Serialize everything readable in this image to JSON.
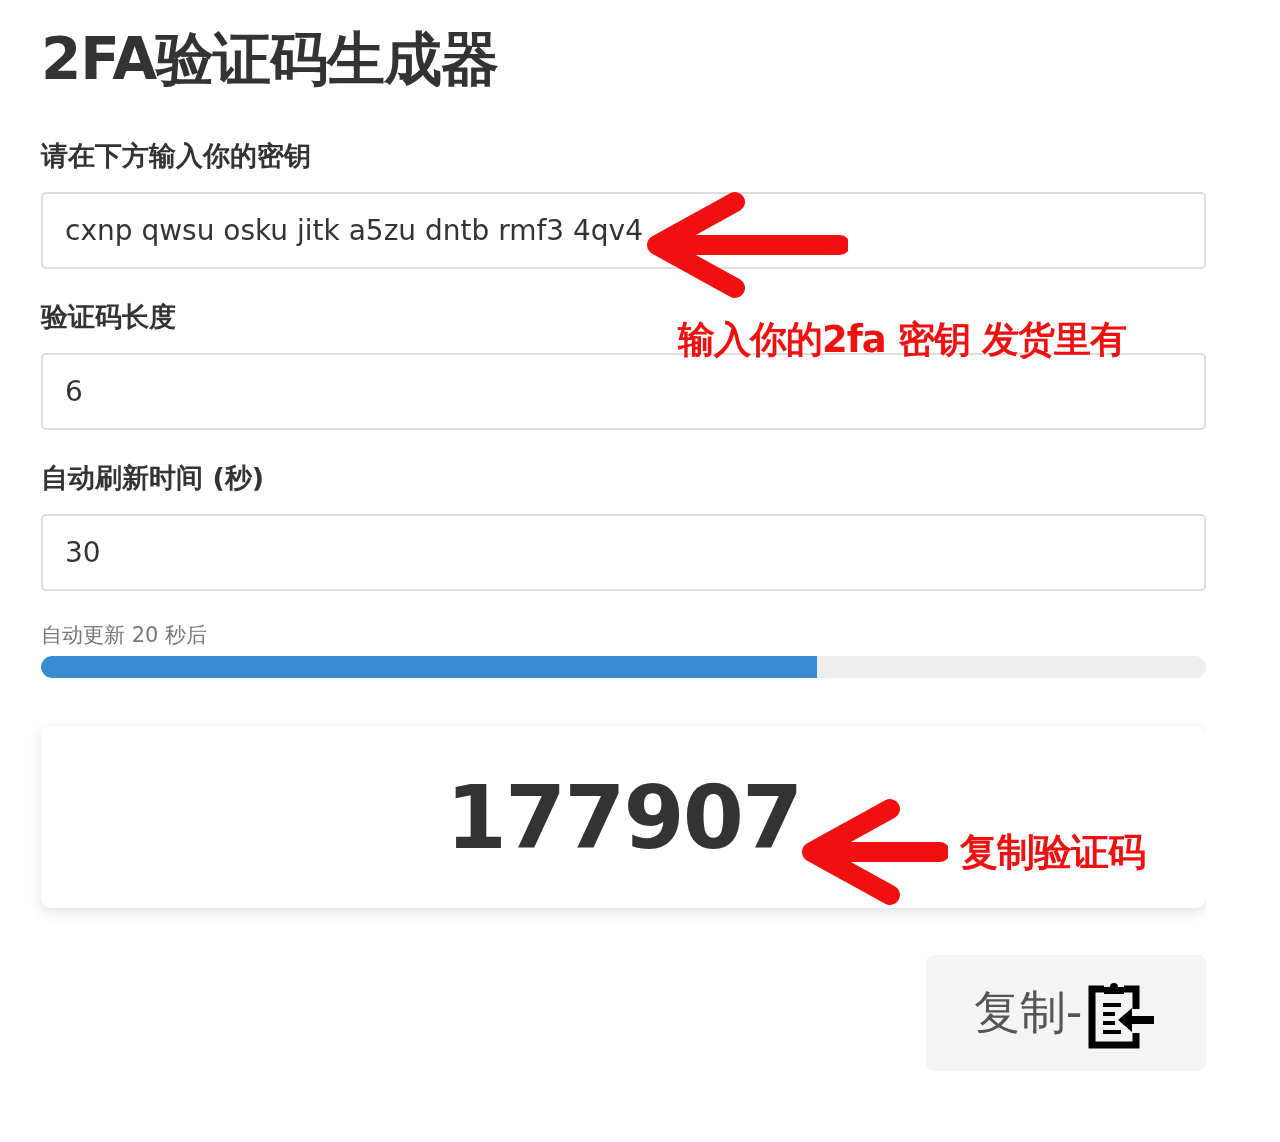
{
  "title": "2FA验证码生成器",
  "fields": [
    {
      "label": "请在下方输入你的密钥",
      "value": "cxnp qwsu osku jitk a5zu dntb rmf3 4qv4"
    },
    {
      "label": "验证码长度",
      "value": "6"
    },
    {
      "label": "自动刷新时间 (秒)",
      "value": "30"
    }
  ],
  "progress": {
    "label": "自动更新 20 秒后",
    "level": 0.666
  },
  "code": "177907",
  "copy_button": {
    "label": "复制-"
  },
  "annotations": [
    {
      "text": "输入你的2fa 密钥 发货里有",
      "kind": "field"
    },
    {
      "text": "复制验证码",
      "kind": "code"
    }
  ]
}
